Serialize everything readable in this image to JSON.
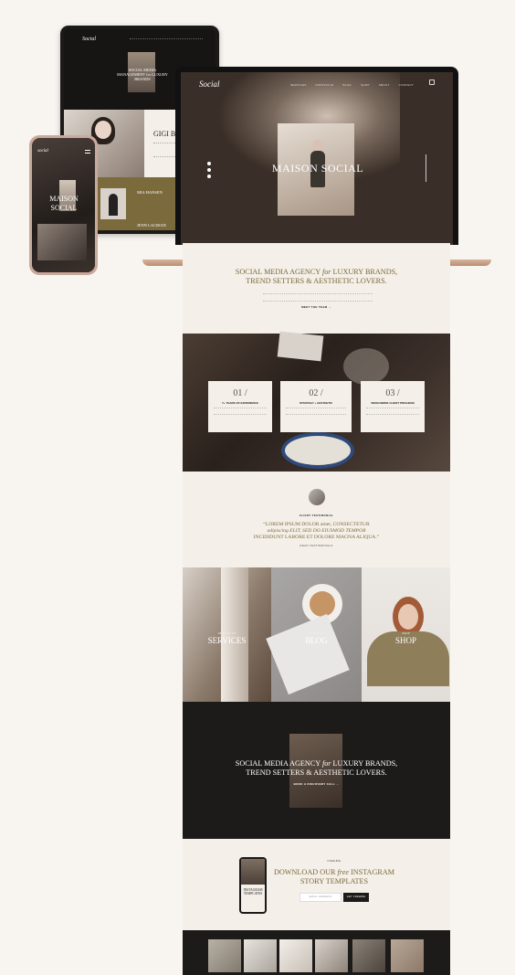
{
  "tablet": {
    "logo": "Social",
    "hero_text": "SOCIAL MEDIA MANAGEMENT for LUXURY BRANDS",
    "person_name": "GIGI BUR",
    "person_name2": "MIA HANSEN",
    "person_name3": "JENN LACROIX"
  },
  "laptop": {
    "logo": "Social",
    "nav": [
      "SERVICES",
      "PORTFOLIO",
      "BLOG",
      "SHOP",
      "ABOUT",
      "CONTACT"
    ],
    "hero_title": "MAISON SOCIAL"
  },
  "phone": {
    "logo": "social",
    "hero_title": "MAISON SOCIAL"
  },
  "intro": {
    "headline_1": "SOCIAL MEDIA AGENCY",
    "headline_italic": "for",
    "headline_2": "LUXURY BRANDS,",
    "headline_3": "TREND SETTERS & AESTHETIC LOVERS.",
    "cta": "MEET THE TEAM →"
  },
  "stats": {
    "cards": [
      {
        "num": "01 /",
        "title": "7+ YEARS OF EXPERIENCE"
      },
      {
        "num": "02 /",
        "title": "STRATEGY + AESTHETIC"
      },
      {
        "num": "03 /",
        "title": "WORLDWIDE CLIENT PROGRAM"
      }
    ]
  },
  "testimonial": {
    "label": "CLIENT TESTIMONIAL",
    "quote_1": "“LOREM IPSUM DOLOR amet, CONSECTETUR",
    "quote_2": "adipiscing ELIT, SED DO EIUSMOD TEMPOR",
    "quote_3": "INCIDIDUNT LABORE ET DOLORE MAGNA ALIQUA.”",
    "link": "READ TESTIMONIALS"
  },
  "tiles": [
    {
      "sub": "WHAT WE DO",
      "label": "SERVICES"
    },
    {
      "sub": "READ MORE",
      "label": "BLOG"
    },
    {
      "sub": "SHOP",
      "label": "SHOP"
    }
  ],
  "dark_cta": {
    "headline_1": "SOCIAL MEDIA AGENCY",
    "headline_italic": "for",
    "headline_2": "LUXURY BRANDS,",
    "headline_3": "TREND SETTERS & AESTHETIC LOVERS.",
    "cta": "BOOK A DISCOVERY CALL →"
  },
  "download": {
    "label": "FREEBIE",
    "title_1": "DOWNLOAD OUR",
    "title_italic": "free",
    "title_2": "INSTAGRAM",
    "title_3": "STORY TEMPLATES",
    "email_placeholder": "EMAIL ADDRESS",
    "button": "GET FREEBIE",
    "phone_text_1": "INSTAGRAM",
    "phone_text_2": "TEMPLATES"
  },
  "colors": {
    "cream": "#f4efe8",
    "dark": "#1c1b1a",
    "olive": "#7a6a3c",
    "accent": "#c9a99a"
  }
}
